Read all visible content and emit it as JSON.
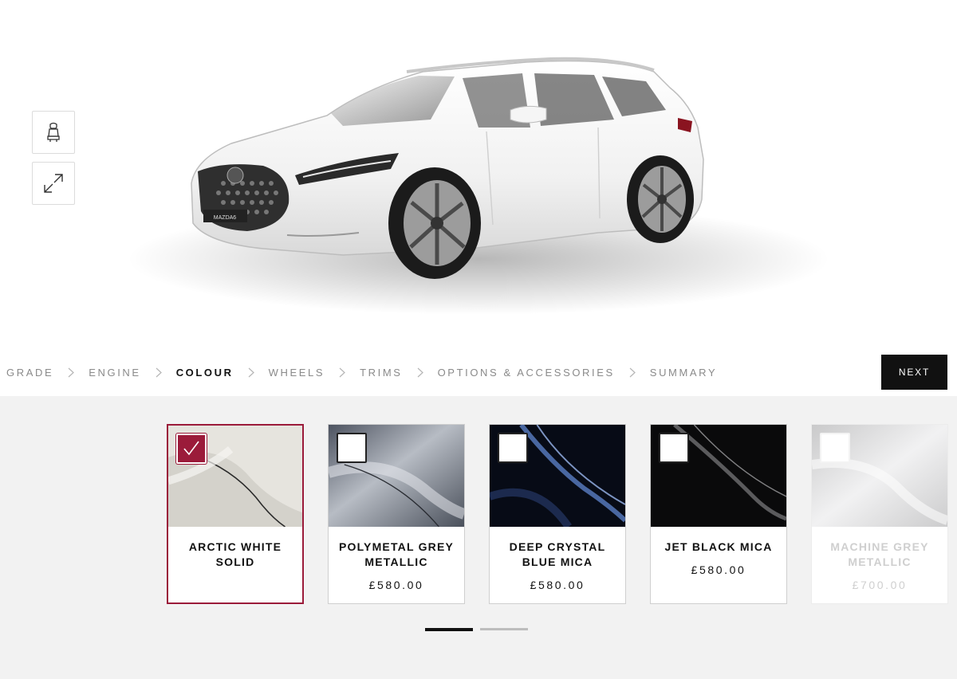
{
  "viewer": {
    "car_model_badge": "MAZDA6",
    "buttons": [
      {
        "name": "interior-view-button",
        "icon": "car-seat-icon"
      },
      {
        "name": "fullscreen-button",
        "icon": "expand-arrows-icon"
      }
    ]
  },
  "steps": {
    "items": [
      "GRADE",
      "ENGINE",
      "COLOUR",
      "WHEELS",
      "TRIMS",
      "OPTIONS & ACCESSORIES",
      "SUMMARY"
    ],
    "active": "COLOUR",
    "next_label": "NEXT"
  },
  "colours": [
    {
      "name": "ARCTIC WHITE SOLID",
      "price": "",
      "selected": true,
      "available": true,
      "swatch": "#e7e5df"
    },
    {
      "name": "POLYMETAL GREY METALLIC",
      "price": "£580.00",
      "selected": false,
      "available": true,
      "swatch": "#7a808b"
    },
    {
      "name": "DEEP CRYSTAL BLUE MICA",
      "price": "£580.00",
      "selected": false,
      "available": true,
      "swatch": "#0c1428"
    },
    {
      "name": "JET BLACK MICA",
      "price": "£580.00",
      "selected": false,
      "available": true,
      "swatch": "#0b0b0c"
    },
    {
      "name": "MACHINE GREY METALLIC",
      "price": "£700.00",
      "selected": false,
      "available": false,
      "swatch": "#cfcfcf"
    }
  ],
  "pager": {
    "pages": 2,
    "current": 1
  },
  "accent_color": "#9b1b3a"
}
